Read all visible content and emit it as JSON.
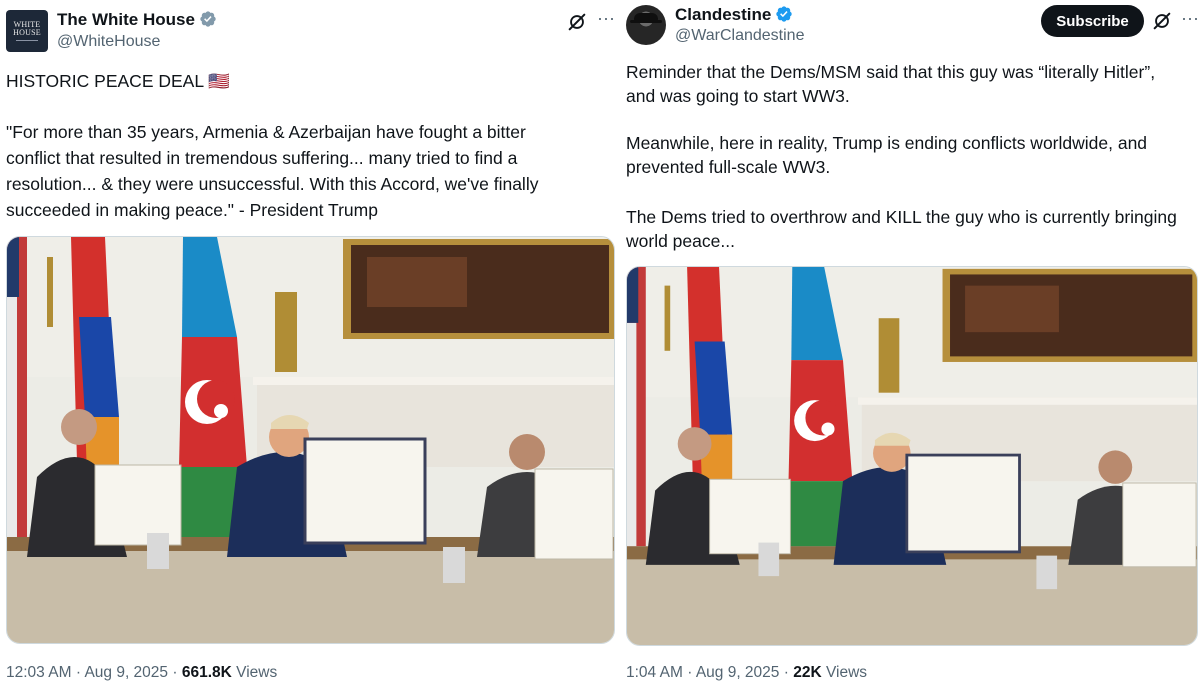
{
  "left_post": {
    "author_name": "The White House",
    "author_handle": "@WhiteHouse",
    "avatar_text_line1": "WHITE",
    "avatar_text_line2": "HOUSE",
    "text_title": "HISTORIC PEACE DEAL",
    "flag_emoji": "🇺🇸",
    "text_lines": [
      "\"For more than 35 years, Armenia & Azerbaijan have fought a bitter",
      "conflict that resulted in tremendous suffering... many tried to find a",
      "resolution... & they were unsuccessful. With this Accord, we've finally",
      "succeeded in making peace.\" - President Trump"
    ],
    "time": "12:03 AM",
    "date": "Aug 9, 2025",
    "views_count": "661.8K",
    "views_label": "Views"
  },
  "right_post": {
    "author_name": "Clandestine",
    "author_handle": "@WarClandestine",
    "subscribe_label": "Subscribe",
    "text_lines": [
      "Reminder that the Dems/MSM said that this guy was “literally Hitler”,",
      "and was going to start WW3.",
      "",
      "Meanwhile, here in reality, Trump is ending conflicts worldwide, and",
      "prevented full-scale WW3.",
      "",
      "The Dems tried to overthrow and KILL the guy who is currently bringing",
      "world peace..."
    ],
    "time": "1:04 AM",
    "date": "Aug 9, 2025",
    "views_count": "22K",
    "views_label": "Views"
  },
  "colors": {
    "verified_blue": "#1d9bf0",
    "text_primary": "#0f1419",
    "text_secondary": "#536471"
  },
  "icons": {
    "verified": "verified-badge-icon",
    "grok": "grok-icon",
    "more": "more-icon"
  }
}
